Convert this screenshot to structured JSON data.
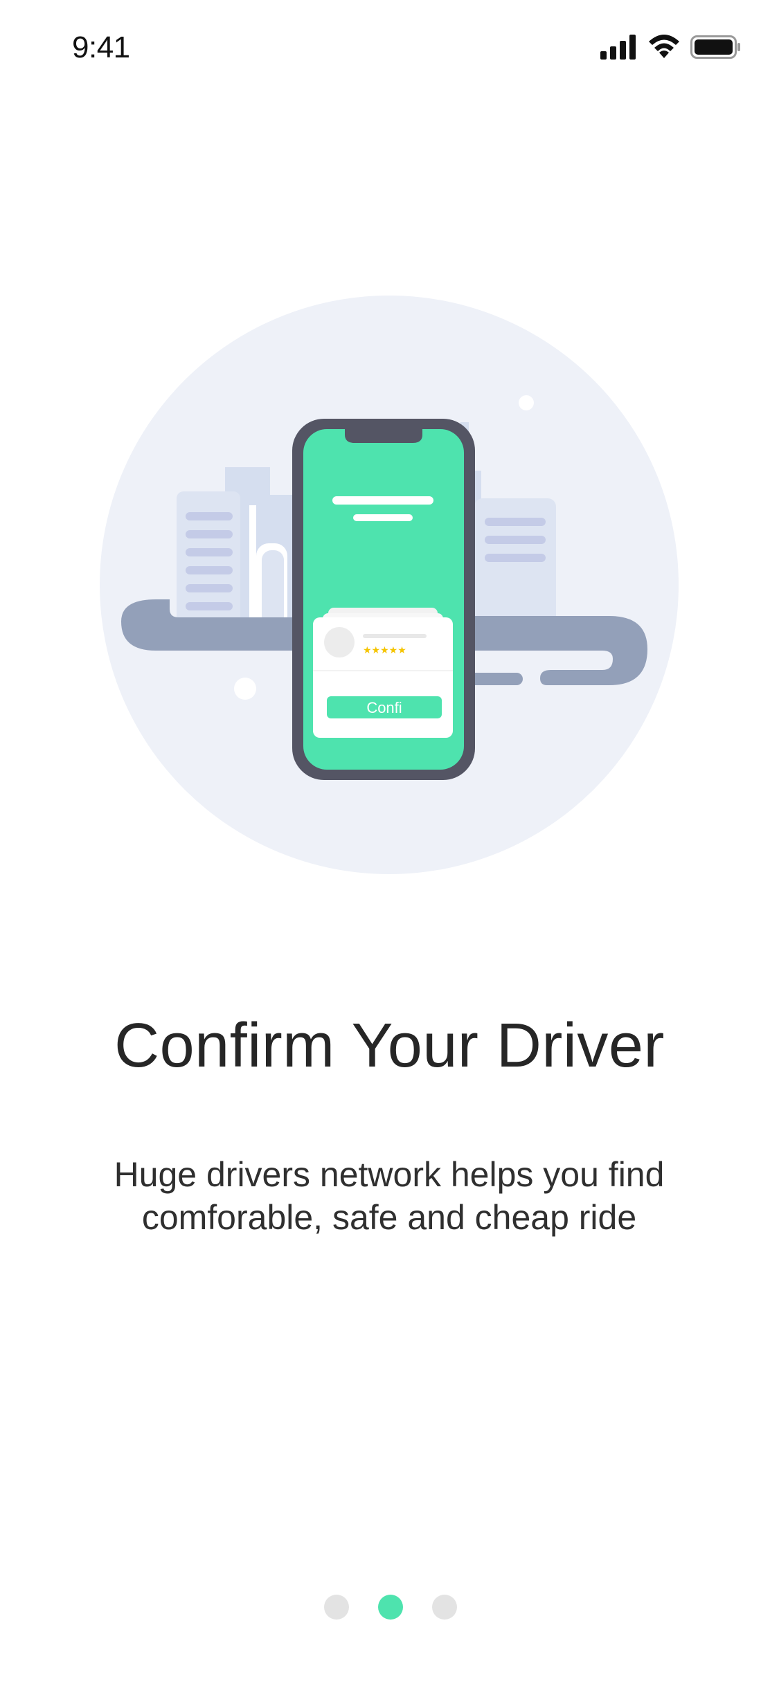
{
  "status_bar": {
    "time": "9:41",
    "icons": [
      "cellular-signal-icon",
      "wifi-icon",
      "battery-icon"
    ]
  },
  "illustration": {
    "phone_button_label": "Confi",
    "rating_stars": "★★★★★",
    "colors": {
      "accent": "#4ee3ae",
      "circle_bg": "#eef1f8",
      "phone_frame": "#545564",
      "road": "#93a0b9",
      "buildings": "#d5deef",
      "star": "#f5c400"
    }
  },
  "onboarding": {
    "title": "Confirm Your Driver",
    "subtitle_line1": "Huge drivers network helps you find",
    "subtitle_line2": "comforable, safe and cheap ride"
  },
  "pager": {
    "pages": 3,
    "active_index": 1
  }
}
